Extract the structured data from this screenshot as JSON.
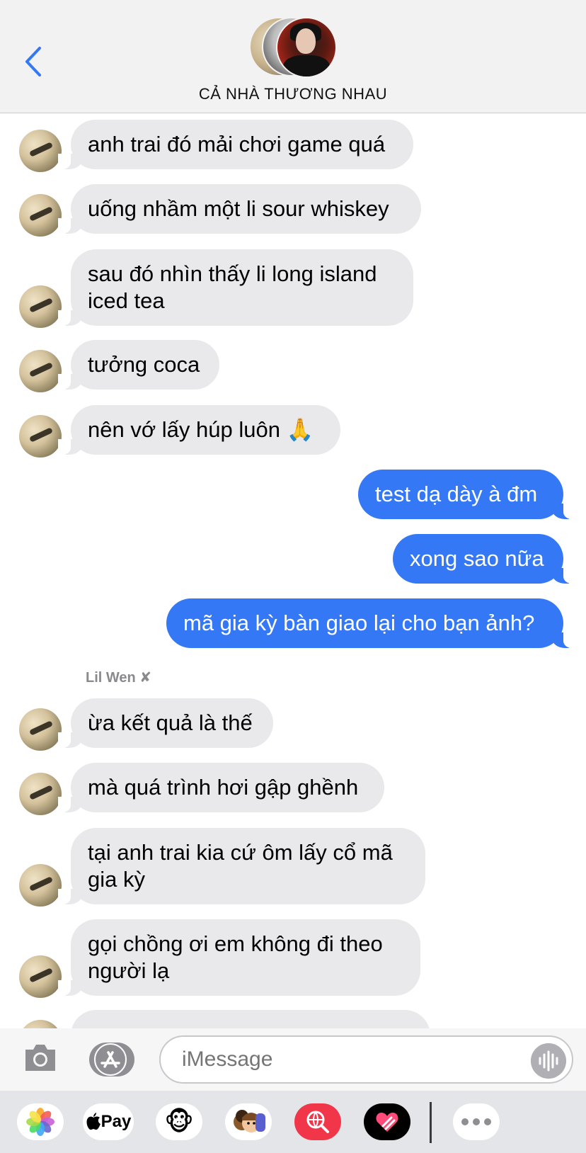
{
  "header": {
    "group_title": "CẢ NHÀ THƯƠNG NHAU"
  },
  "messages": [
    {
      "direction": "incoming",
      "text": "anh trai đó mải chơi game quá"
    },
    {
      "direction": "incoming",
      "text": "uống nhầm một li sour whiskey"
    },
    {
      "direction": "incoming",
      "text": "sau đó nhìn thấy li long island iced tea"
    },
    {
      "direction": "incoming",
      "text": "tưởng coca"
    },
    {
      "direction": "incoming",
      "text": "nên vớ lấy húp luôn 🙏"
    },
    {
      "direction": "outgoing",
      "text": "test dạ dày à đm"
    },
    {
      "direction": "outgoing",
      "text": "xong sao nữa"
    },
    {
      "direction": "outgoing",
      "text": "mã gia kỳ bàn giao lại cho bạn ảnh?"
    },
    {
      "direction": "incoming",
      "text": "ừa kết quả là thế"
    },
    {
      "direction": "incoming",
      "text": "mà quá trình hơi gập ghềnh"
    },
    {
      "direction": "incoming",
      "text": "tại anh trai kia cứ ôm lấy cổ mã gia kỳ"
    },
    {
      "direction": "incoming",
      "text": "gọi chồng ơi em không đi theo người lạ"
    }
  ],
  "sender_label": "Lil Wen ✘",
  "input": {
    "placeholder": "iMessage"
  },
  "app_strip": {
    "apple_pay_label": "Pay",
    "memoji_glyph": "🐵",
    "memoji_stickers_glyph": "🧑‍🤝‍🧑"
  },
  "colors": {
    "accent": "#3478f6",
    "incoming_bubble": "#e9e9eb",
    "header_bg": "#f2f2f2"
  }
}
